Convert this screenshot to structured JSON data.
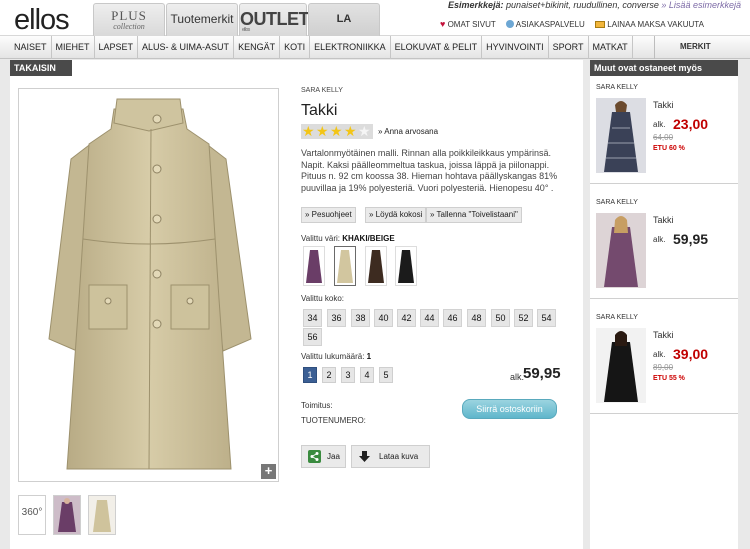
{
  "header": {
    "logo": "ellos",
    "brands": {
      "plus": "PLUS",
      "plus_sub": "collection",
      "tuotemerkit": "Tuotemerkit",
      "outlet_prefix": "ellos",
      "outlet": "OUTLET",
      "redoute": "LA REDOUTE"
    },
    "search_hint_label": "Esimerkkejä:",
    "search_hint_text": " punaiset+bikinit, ruudullinen, converse",
    "search_hint_link": "» Lisää esimerkkejä",
    "links": {
      "omat_sivut": "OMAT SIVUT",
      "asiakaspalvelu": "ASIAKASPALVELU",
      "lainaa": "LAINAA MAKSA VAKUUTA"
    }
  },
  "nav": {
    "items": [
      "NAISET",
      "MIEHET",
      "LAPSET",
      "ALUS- & UIMA-ASUT",
      "KENGÄT",
      "KOTI",
      "ELEKTRONIIKKA",
      "ELOKUVAT & PELIT",
      "HYVINVOINTI",
      "SPORT",
      "MATKAT"
    ],
    "merkit": "MERKIT"
  },
  "main": {
    "back": "TAKAISIN",
    "zoom": "+",
    "thumb_360": "360°"
  },
  "product": {
    "brand": "SARA KELLY",
    "title": "Takki",
    "rating": 4,
    "rating_link": "» Anna arvosana",
    "description": "Vartalonmyötäinen malli. Rinnan alla poikkileikkaus ympärinsä. Napit. Kaksi päälleommeltua taskua, joissa läppä ja piilonappi. Pituus n. 92 cm koossa 38. Hieman hohtava päällyskangas 81% puuvillaa ja 19% polyesteriä. Vuori polyesteriä. Hienopesu 40°  .",
    "buttons": {
      "pesuohjeet": "» Pesuohjeet",
      "loyda_kokosi": "» Löydä kokosi",
      "tallenna": "» Tallenna \"Toivelistaani\""
    },
    "color_label": "Valittu väri:",
    "color_value": "KHAKI/BEIGE",
    "swatches": [
      "purple",
      "beige",
      "brown",
      "black"
    ],
    "size_label": "Valittu koko:",
    "sizes": [
      "34",
      "36",
      "38",
      "40",
      "42",
      "44",
      "46",
      "48",
      "50",
      "52",
      "54",
      "56"
    ],
    "qty_label": "Valittu lukumäärä:",
    "qty_value": "1",
    "quantities": [
      "1",
      "2",
      "3",
      "4",
      "5"
    ],
    "price_prefix": "alk.",
    "price": "59,95",
    "toimitus": "Toimitus:",
    "tuotenumero": "TUOTENUMERO:",
    "cart": "Siirrä ostoskoriin",
    "share": "Jaa",
    "download": "Lataa kuva"
  },
  "sidebar": {
    "title": "Muut ovat ostaneet myös",
    "items": [
      {
        "brand": "SARA KELLY",
        "name": "Takki",
        "prefix": "alk.",
        "price": "23,00",
        "old_price": "64,00",
        "discount": "ETU 60 %",
        "color": "#c00000"
      },
      {
        "brand": "SARA KELLY",
        "name": "Takki",
        "prefix": "alk.",
        "price": "59,95",
        "color": "#222222"
      },
      {
        "brand": "SARA KELLY",
        "name": "Takki",
        "prefix": "alk.",
        "price": "39,00",
        "old_price": "89,00",
        "discount": "ETU 55 %",
        "color": "#c00000"
      }
    ]
  },
  "colors": {
    "accent_blue": "#3b5f94",
    "cart_blue": "#5fb6cb",
    "sale_red": "#c00000",
    "dark_header": "#4a4a4a"
  }
}
